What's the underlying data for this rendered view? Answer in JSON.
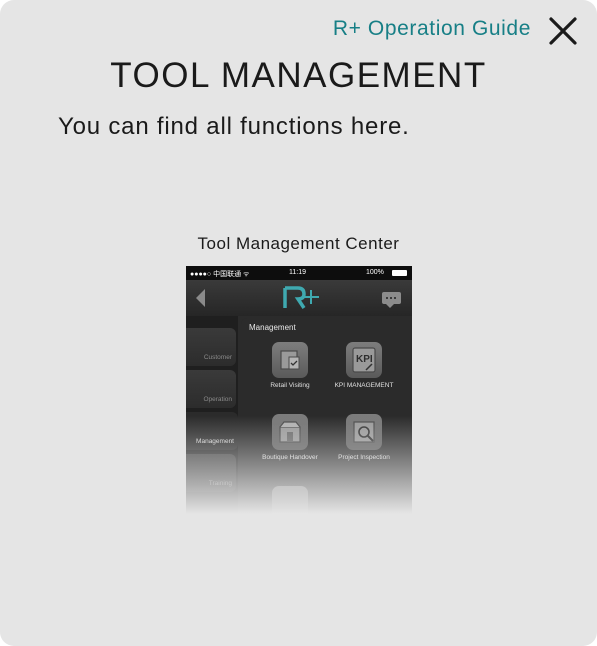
{
  "header": {
    "guide_link": "R+ Operation Guide",
    "close_icon": "close-icon"
  },
  "page": {
    "title": "TOOL MANAGEMENT",
    "subtitle": "You can find all functions here.",
    "screenshot_caption": "Tool Management Center"
  },
  "phone": {
    "status_bar": {
      "carrier": "●●●●○ 中国联通 ᯤ",
      "time": "11:19",
      "battery": "100%"
    },
    "nav": {
      "back_icon": "back-arrow-icon",
      "logo_icon": "r-plus-logo-icon",
      "chat_icon": "chat-icon"
    },
    "side_menu": [
      {
        "label": "Customer"
      },
      {
        "label": "Operation"
      },
      {
        "label": "Management",
        "active": true
      },
      {
        "label": "Training"
      }
    ],
    "content": {
      "header": "Management",
      "tools": [
        {
          "label": "Retail Visiting",
          "icon": "retail-visiting-icon"
        },
        {
          "label": "KPI MANAGEMENT",
          "icon": "kpi-management-icon"
        },
        {
          "label": "Boutique Handover",
          "icon": "boutique-handover-icon"
        },
        {
          "label": "Project Inspection",
          "icon": "project-inspection-icon"
        }
      ]
    }
  },
  "colors": {
    "accent": "#177f86",
    "panel_bg": "#e5e5e5",
    "text": "#1a1a1a"
  }
}
